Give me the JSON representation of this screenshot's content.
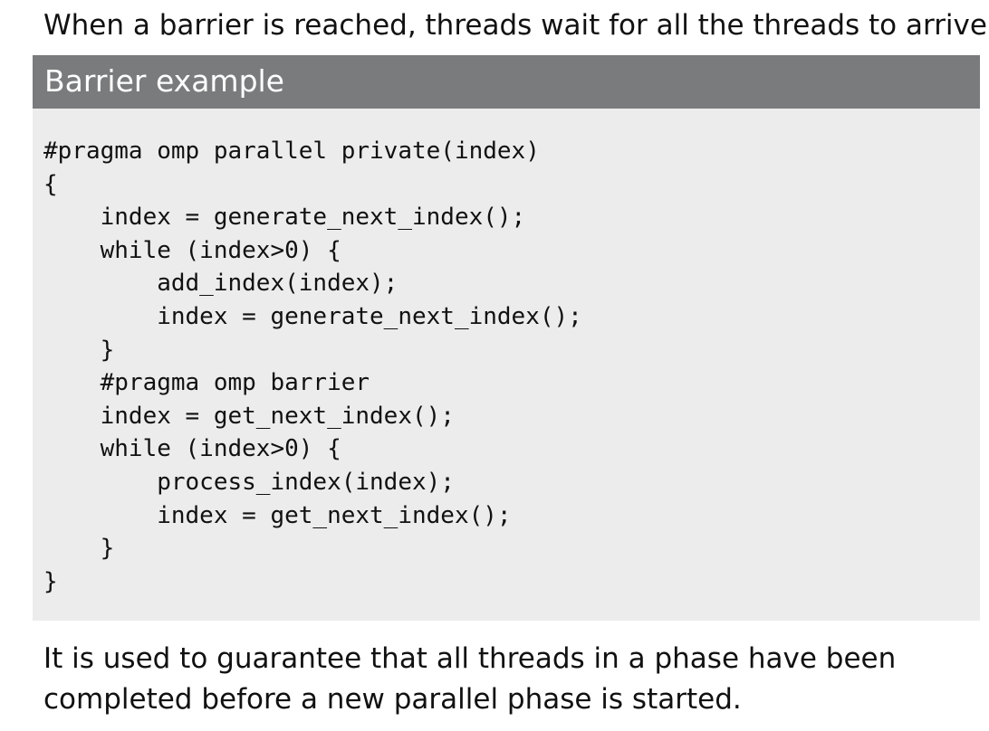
{
  "intro_text": "When a barrier is reached, threads wait for all the threads to arrive.",
  "block": {
    "title": "Barrier example",
    "code_lines": [
      "#pragma omp parallel private(index)",
      "{",
      "    index = generate_next_index();",
      "    while (index>0) {",
      "        add_index(index);",
      "        index = generate_next_index();",
      "    }",
      "    #pragma omp barrier",
      "    index = get_next_index();",
      "    while (index>0) {",
      "        process_index(index);",
      "        index = get_next_index();",
      "    }",
      "}"
    ]
  },
  "outro_lines": [
    "It is used to guarantee that all threads in a phase have been",
    "completed before a new parallel phase is started."
  ],
  "colors": {
    "header_background": "#7a7b7d",
    "block_background": "#ececec",
    "text": "#111111"
  }
}
